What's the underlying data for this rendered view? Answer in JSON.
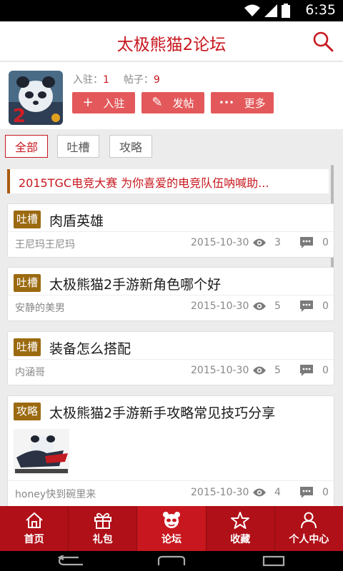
{
  "statusbar": {
    "time": "6:35"
  },
  "header": {
    "title": "太极熊猫2论坛",
    "search_icon": "search-icon"
  },
  "profile": {
    "joined_label": "入驻：",
    "joined_count": "1",
    "posts_label": "帖子：",
    "posts_count": "9",
    "actions": [
      {
        "icon": "+",
        "label": "入驻"
      },
      {
        "icon": "✎",
        "label": "发帖"
      },
      {
        "icon": "•••",
        "label": "更多"
      }
    ]
  },
  "filters": [
    {
      "label": "全部",
      "active": true
    },
    {
      "label": "吐槽",
      "active": false
    },
    {
      "label": "攻略",
      "active": false
    }
  ],
  "banner": {
    "text": "2015TGC电竞大赛 为你喜爱的电竞队伍呐喊助..."
  },
  "posts": [
    {
      "tag": "吐槽",
      "title": "肉盾英雄",
      "author": "王尼玛王尼玛",
      "date": "2015-10-30",
      "views": "3",
      "comments": "0"
    },
    {
      "tag": "吐槽",
      "title": "太极熊猫2手游新角色哪个好",
      "author": "安静的美男",
      "date": "2015-10-30",
      "views": "5",
      "comments": "0"
    },
    {
      "tag": "吐槽",
      "title": "装备怎么搭配",
      "author": "内涵哥",
      "date": "2015-10-30",
      "views": "5",
      "comments": "0"
    },
    {
      "tag": "攻略",
      "title": "太极熊猫2手游新手攻略常见技巧分享",
      "author": "honey快到碗里来",
      "date": "2015-10-30",
      "views": "4",
      "comments": "0"
    }
  ],
  "tabs": [
    {
      "label": "首页",
      "icon": "home-icon"
    },
    {
      "label": "礼包",
      "icon": "gift-icon"
    },
    {
      "label": "论坛",
      "icon": "forum-icon",
      "active": true
    },
    {
      "label": "收藏",
      "icon": "star-icon"
    },
    {
      "label": "个人中心",
      "icon": "user-icon"
    }
  ],
  "colors": {
    "brand": "#c8171e",
    "tag": "#9b6a10",
    "tabbar": "#b01018",
    "button": "#e3595b"
  }
}
